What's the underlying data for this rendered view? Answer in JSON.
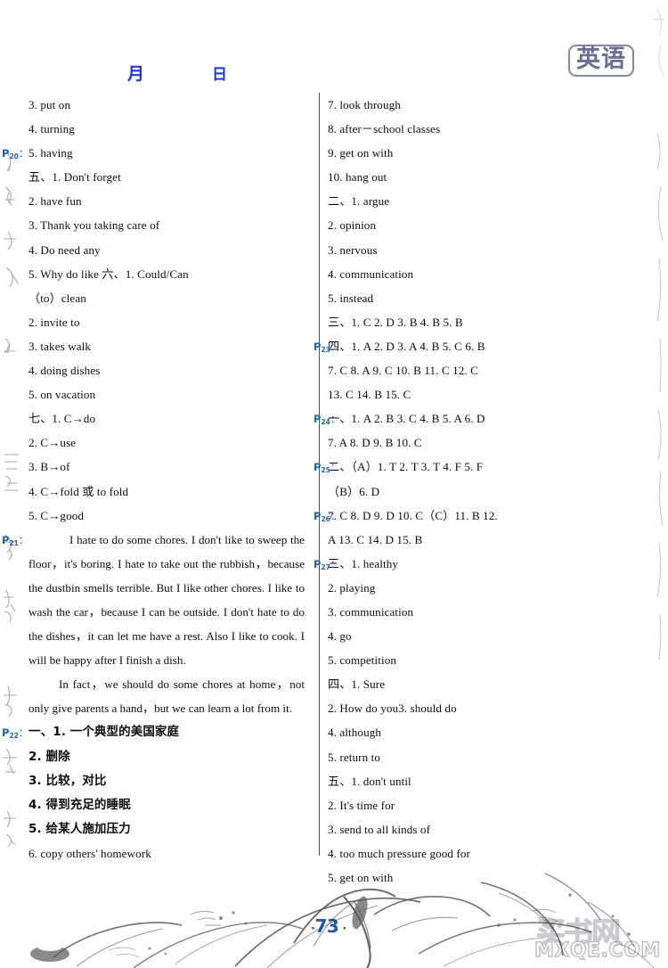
{
  "header": {
    "month_label": "月",
    "day_label": "日",
    "subject_label": "英语"
  },
  "footer": {
    "page_number": "73",
    "watermark_cn": "买书网",
    "watermark_url": "MXQE.COM"
  },
  "left_column": {
    "lines": [
      {
        "marker": "",
        "sub": "",
        "text": "3.  put on"
      },
      {
        "marker": "",
        "sub": "",
        "text": "4.  turning"
      },
      {
        "marker": "P",
        "sub": "20",
        "text": "5.  having"
      },
      {
        "marker": "",
        "sub": "",
        "text": "五、1.  Don't    forget"
      },
      {
        "marker": "",
        "sub": "",
        "text": "2.  have    fun"
      },
      {
        "marker": "",
        "sub": "",
        "text": "3.  Thank    you    taking    care    of"
      },
      {
        "marker": "",
        "sub": "",
        "text": "4.  Do    need    any"
      },
      {
        "marker": "",
        "sub": "",
        "text": "5.  Why        do        like   六、1.  Could/Can"
      },
      {
        "marker": "",
        "sub": "",
        "text": "（to）clean"
      },
      {
        "marker": "",
        "sub": "",
        "text": "2.  invite    to"
      },
      {
        "marker": "",
        "sub": "",
        "text": "3.  takes    walk"
      },
      {
        "marker": "",
        "sub": "",
        "text": "4.  doing    dishes"
      },
      {
        "marker": "",
        "sub": "",
        "text": "5.  on    vacation"
      },
      {
        "marker": "",
        "sub": "",
        "text": "七、1.  C→do"
      },
      {
        "marker": "",
        "sub": "",
        "text": "2.  C→use"
      },
      {
        "marker": "",
        "sub": "",
        "text": "3.  B→of"
      },
      {
        "marker": "",
        "sub": "",
        "text": "4.  C→fold 或 to fold"
      },
      {
        "marker": "",
        "sub": "",
        "text": "5.  C→good"
      }
    ],
    "paragraph_1": {
      "marker": "P",
      "sub": "21",
      "text": "I hate to do some chores.  I don't like to sweep the floor，it's boring.  I hate to take out the rubbish，because the dustbin smells terrible.  But I like other chores.  I like to wash the car，because I can be outside.  I don't hate to do the dishes，it can let me have a rest.  Also I like to cook.  I will be happy after I finish a dish."
    },
    "paragraph_2": {
      "text": "In fact，we should do some chores at home，not only give parents a hand，but we can learn a lot from it."
    },
    "lines_after": [
      {
        "marker": "P",
        "sub": "22",
        "text": "一、1.  一个典型的美国家庭",
        "cn": true
      },
      {
        "marker": "",
        "sub": "",
        "text": "2.  删除",
        "cn": true
      },
      {
        "marker": "",
        "sub": "",
        "text": "3.  比较，对比",
        "cn": true
      },
      {
        "marker": "",
        "sub": "",
        "text": "4.  得到充足的睡眠",
        "cn": true
      },
      {
        "marker": "",
        "sub": "",
        "text": "5.  给某人施加压力",
        "cn": true
      },
      {
        "marker": "",
        "sub": "",
        "text": "6.  copy others' homework",
        "cn": false
      }
    ]
  },
  "right_column": {
    "lines": [
      {
        "marker": "",
        "sub": "",
        "text": "7.  look through"
      },
      {
        "marker": "",
        "sub": "",
        "text": "8.  after－school classes"
      },
      {
        "marker": "",
        "sub": "",
        "text": "9.  get on with"
      },
      {
        "marker": "",
        "sub": "",
        "text": "10.  hang out"
      },
      {
        "marker": "",
        "sub": "",
        "text": "二、1.  argue"
      },
      {
        "marker": "",
        "sub": "",
        "text": "2.  opinion"
      },
      {
        "marker": "",
        "sub": "",
        "text": "3.  nervous"
      },
      {
        "marker": "",
        "sub": "",
        "text": "4.  communication"
      },
      {
        "marker": "",
        "sub": "",
        "text": "5.  instead"
      },
      {
        "marker": "",
        "sub": "",
        "text": "三、1.  C  2.  D  3.  B  4.  B  5.  B"
      },
      {
        "marker": "P",
        "sub": "23",
        "text": "四、1.  A  2.  D  3.  A  4.  B  5.  C  6.  B"
      },
      {
        "marker": "",
        "sub": "",
        "text": "7.  C  8.  A   9.  C   10.  B   11.  C   12.  C"
      },
      {
        "marker": "",
        "sub": "",
        "text": "13.  C   14.  B   15.  C"
      },
      {
        "marker": "P",
        "sub": "24",
        "text": "一、1.  A  2.  B  3.  C  4.  B  5.  A  6.  D"
      },
      {
        "marker": "",
        "sub": "",
        "text": "7.  A  8.  D  9.  B  10.  C"
      },
      {
        "marker": "P",
        "sub": "25",
        "text": "二、（A）1.  T   2.  T   3.  T   4.  F   5.  F"
      },
      {
        "marker": "",
        "sub": "",
        "text": "（B）6.  D"
      },
      {
        "marker": "P",
        "sub": "26",
        "text": "7.  C   8.  D   9.  D   10.  C（C）11.  B   12."
      },
      {
        "marker": "",
        "sub": "",
        "text": "A   13.  C   14.  D   15.  B"
      },
      {
        "marker": "P",
        "sub": "27",
        "text": "三、1.  healthy"
      },
      {
        "marker": "",
        "sub": "",
        "text": "2.  playing"
      },
      {
        "marker": "",
        "sub": "",
        "text": "3.  communication"
      },
      {
        "marker": "",
        "sub": "",
        "text": "4.  go"
      },
      {
        "marker": "",
        "sub": "",
        "text": "5.  competition"
      },
      {
        "marker": "",
        "sub": "",
        "text": "四、1.  Sure"
      },
      {
        "marker": "",
        "sub": "",
        "text": "2.  How    do    you3.  should    do"
      },
      {
        "marker": "",
        "sub": "",
        "text": "4.  although"
      },
      {
        "marker": "",
        "sub": "",
        "text": "5.  return    to"
      },
      {
        "marker": "",
        "sub": "",
        "text": "五、1.  don't    until"
      },
      {
        "marker": "",
        "sub": "",
        "text": "2.  It's    time    for"
      },
      {
        "marker": "",
        "sub": "",
        "text": "3.  send    to    all    kinds    of"
      },
      {
        "marker": "",
        "sub": "",
        "text": "4.  too    much    pressure    good    for"
      },
      {
        "marker": "",
        "sub": "",
        "text": "5.  get    on    with"
      }
    ]
  }
}
